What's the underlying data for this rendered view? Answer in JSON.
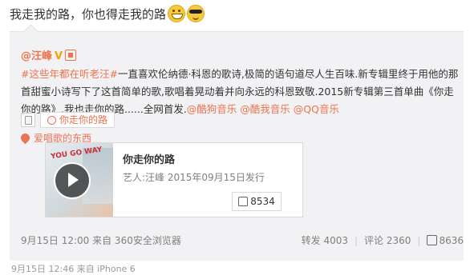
{
  "post": {
    "text": "我走我的路，你也得走我的路",
    "emoji1": "grin-icon",
    "emoji2": "sunglasses-icon"
  },
  "repost": {
    "author": "@汪峰",
    "verified_badge": "V",
    "topic": "#这些年都在听老汪#",
    "body1": "一直喜欢伦纳德·科恩的歌诗,极简的语句道尽人生百味.新专辑里终于用他的那首甜蜜小诗写下了这首简单的歌,歌唱着晃动着并向永远的科恩致敬.2015新专辑第三首单曲《你走你的路》,我也走你的路......全网首发.",
    "link1": "@酷狗音乐",
    "link2": "@酷我音乐",
    "link3": "@QQ音乐",
    "chip_label": "你走你的路",
    "location": "爱唱歌的东西"
  },
  "card": {
    "title": "你走你的路",
    "subtitle": "艺人:汪峰 2015年09月15日发行",
    "likes": "8534",
    "cover_text": "YOU GO WAY"
  },
  "footer": {
    "time": "9月15日 12:00 来自 360安全浏览器",
    "repost_label": "转发 4003",
    "comment_label": "评论 2360",
    "like_count": "8636"
  },
  "peek": {
    "text": "9月15日 12:46 来自 iPhone 6"
  }
}
